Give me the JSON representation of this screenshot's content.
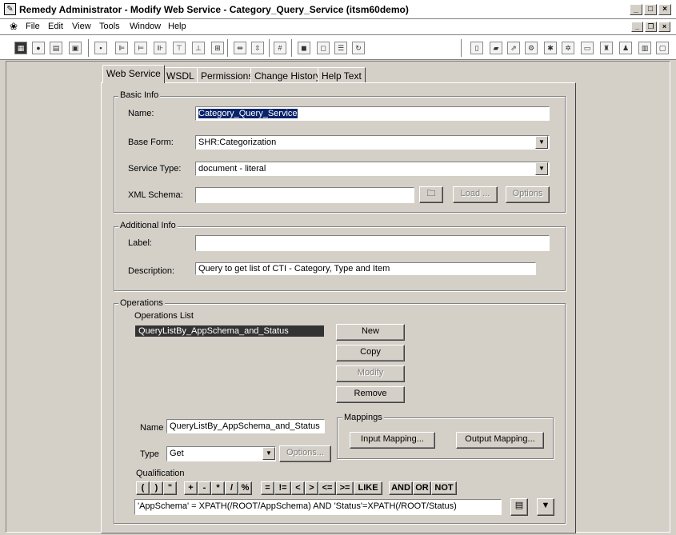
{
  "window": {
    "title": "Remedy Administrator - Modify Web Service - Category_Query_Service (itsm60demo)"
  },
  "menu": [
    "File",
    "Edit",
    "View",
    "Tools",
    "Window",
    "Help"
  ],
  "tabs": [
    "Web Service",
    "WSDL",
    "Permissions",
    "Change History",
    "Help Text"
  ],
  "basic_info": {
    "legend": "Basic Info",
    "name_label": "Name:",
    "name_value": "Category_Query_Service",
    "base_form_label": "Base Form:",
    "base_form_value": "SHR:Categorization",
    "service_type_label": "Service Type:",
    "service_type_value": "document - literal",
    "xml_schema_label": "XML Schema:",
    "xml_schema_value": "",
    "load_label": "Load ...",
    "options_label": "Options"
  },
  "additional_info": {
    "legend": "Additional Info",
    "label_label": "Label:",
    "label_value": "",
    "description_label": "Description:",
    "description_value": "Query to get list of CTI - Category, Type and Item"
  },
  "operations": {
    "legend": "Operations",
    "list_label": "Operations List",
    "list_items": [
      "QueryListBy_AppSchema_and_Status"
    ],
    "new_label": "New",
    "copy_label": "Copy",
    "modify_label": "Modify",
    "remove_label": "Remove",
    "name_label": "Name",
    "name_value": "QueryListBy_AppSchema_and_Status",
    "type_label": "Type",
    "type_value": "Get",
    "type_options_label": "Options...",
    "mappings_legend": "Mappings",
    "input_mapping_label": "Input Mapping...",
    "output_mapping_label": "Output Mapping...",
    "qualification_label": "Qualification",
    "qual_buttons": [
      "(",
      ")",
      "\"",
      "+",
      "-",
      "*",
      "/",
      "%",
      "=",
      "!=",
      "<",
      ">",
      "<=",
      ">=",
      "LIKE",
      "AND",
      "OR",
      "NOT"
    ],
    "qualification_value": "'AppSchema' = XPATH(/ROOT/AppSchema) AND 'Status'=XPATH(/ROOT/Status)"
  }
}
